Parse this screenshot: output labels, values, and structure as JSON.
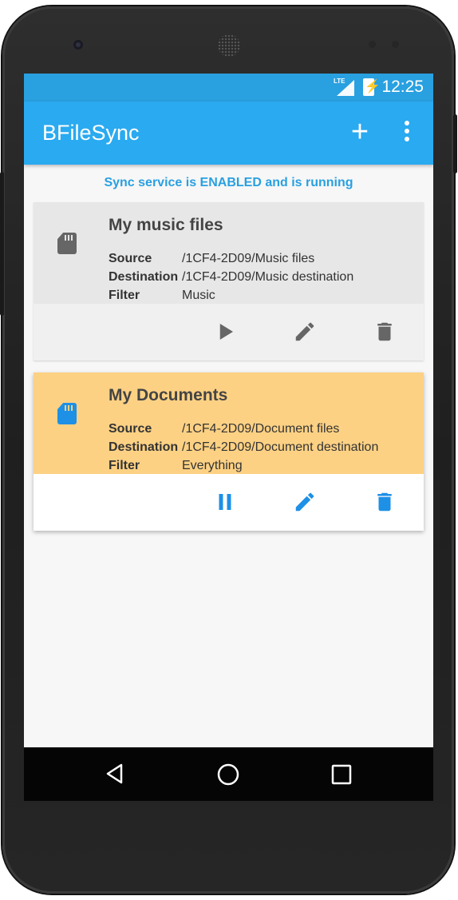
{
  "status_bar": {
    "network": "LTE",
    "time": "12:25"
  },
  "app_bar": {
    "title": "BFileSync",
    "add_icon": "add-icon",
    "more_icon": "more-vert-icon"
  },
  "sync_status": "Sync service is ENABLED and is running",
  "labels": {
    "source": "Source",
    "destination": "Destination",
    "filter": "Filter"
  },
  "jobs": [
    {
      "name": "My music files",
      "source": "/1CF4-2D09/Music files",
      "destination": "/1CF4-2D09/Music destination",
      "filter": "Music",
      "state": "stopped",
      "icon_color": "#666666",
      "actions": [
        "play-icon",
        "edit-icon",
        "delete-icon"
      ]
    },
    {
      "name": "My Documents",
      "source": "/1CF4-2D09/Document files",
      "destination": "/1CF4-2D09/Document destination",
      "filter": "Everything",
      "state": "running",
      "icon_color": "#1e90e6",
      "actions": [
        "pause-icon",
        "edit-icon",
        "delete-icon"
      ]
    }
  ],
  "nav_bar": {
    "back": "back-icon",
    "home": "home-icon",
    "recents": "recents-icon"
  },
  "colors": {
    "accent": "#29a0e0",
    "app_bar": "#2aaaf0",
    "active_card": "#fdd184",
    "inactive_card": "#e7e7e7"
  }
}
